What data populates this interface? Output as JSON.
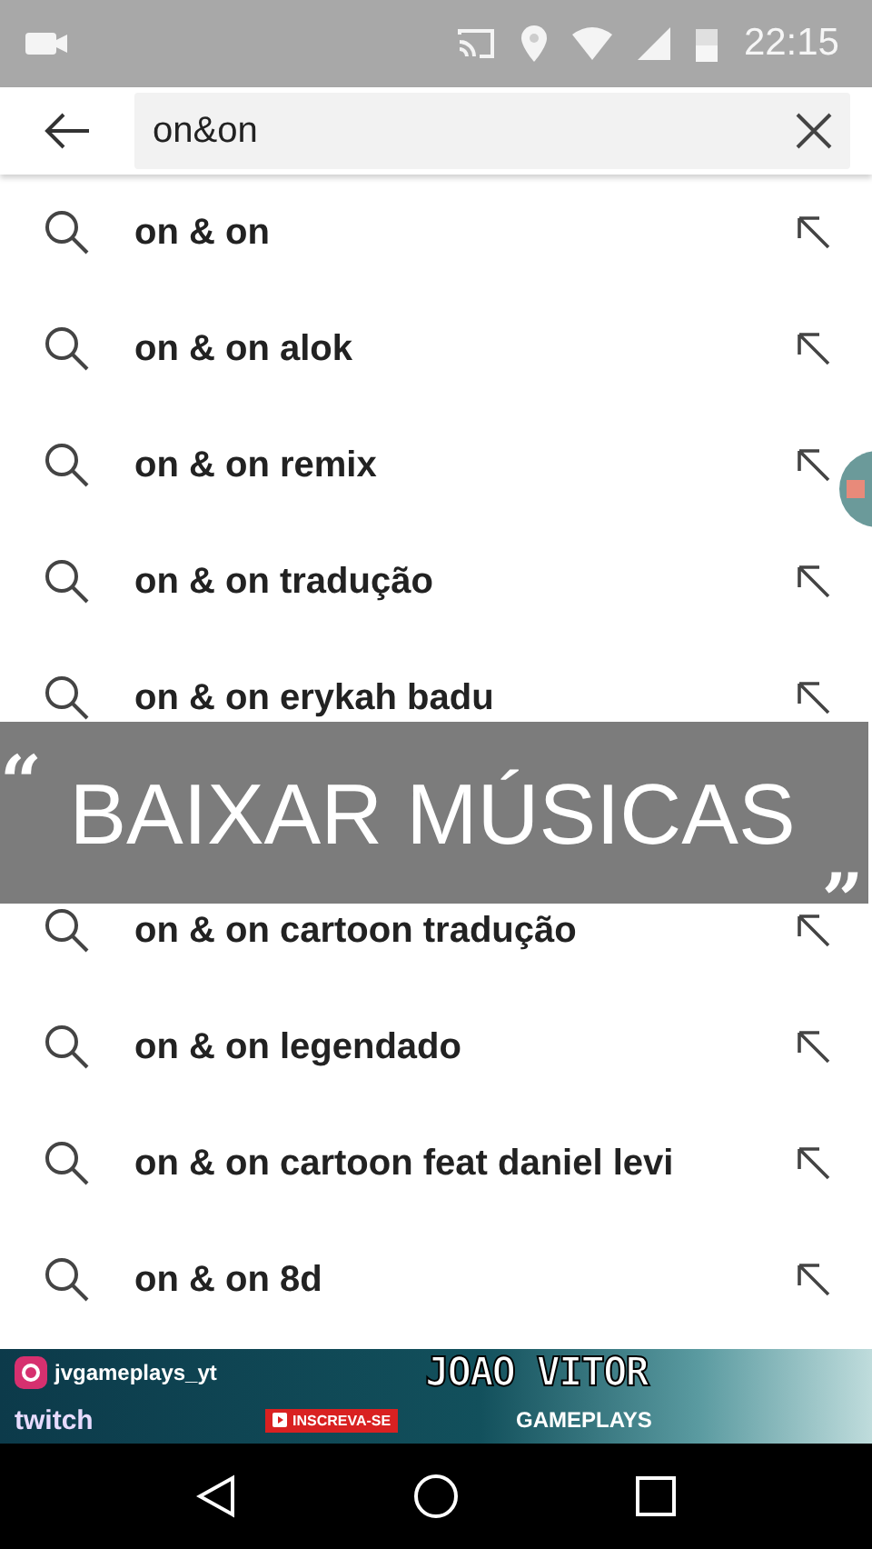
{
  "status_bar": {
    "time": "22:15"
  },
  "search": {
    "value": "on&on"
  },
  "suggestions": [
    {
      "text": "on & on"
    },
    {
      "text": "on & on alok"
    },
    {
      "text": "on & on remix"
    },
    {
      "text": "on & on tradução"
    },
    {
      "text": "on & on erykah badu"
    },
    {
      "text": "on & on cartoon tradução"
    },
    {
      "text": "on & on legendado"
    },
    {
      "text": "on & on cartoon feat daniel levi"
    },
    {
      "text": "on & on 8d"
    }
  ],
  "caption": {
    "open_quote": "“",
    "text": "BAIXAR MÚSICAS",
    "close_quote": "„"
  },
  "banner": {
    "handle": "jvgameplays_yt",
    "platform": "twitch",
    "subscribe": "INSCREVA-SE",
    "title": "JOAO VITOR",
    "subtitle": "GAMEPLAYS"
  }
}
